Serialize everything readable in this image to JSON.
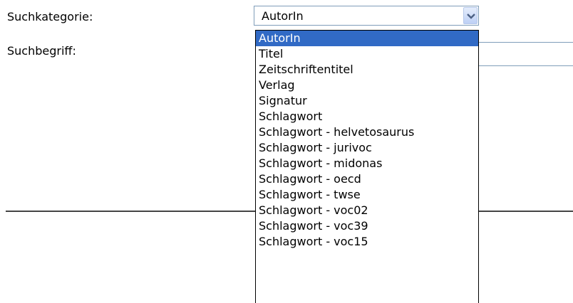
{
  "form": {
    "category_label": "Suchkategorie:",
    "term_label": "Suchbegriff:",
    "category_select": {
      "value": "AutorIn",
      "options": [
        "AutorIn",
        "Titel",
        "Zeitschriftentitel",
        "Verlag",
        "Signatur",
        "Schlagwort",
        "Schlagwort - helvetosaurus",
        "Schlagwort - jurivoc",
        "Schlagwort - midonas",
        "Schlagwort - oecd",
        "Schlagwort - twse",
        "Schlagwort - voc02",
        "Schlagwort - voc39",
        "Schlagwort - voc15"
      ]
    }
  },
  "icons": {
    "dropdown_arrow": "chevron-down-icon"
  },
  "colors": {
    "selected_option_bg": "#316ac5",
    "field_border": "#7f9db9",
    "dropdown_button": "#bdd0f5"
  }
}
